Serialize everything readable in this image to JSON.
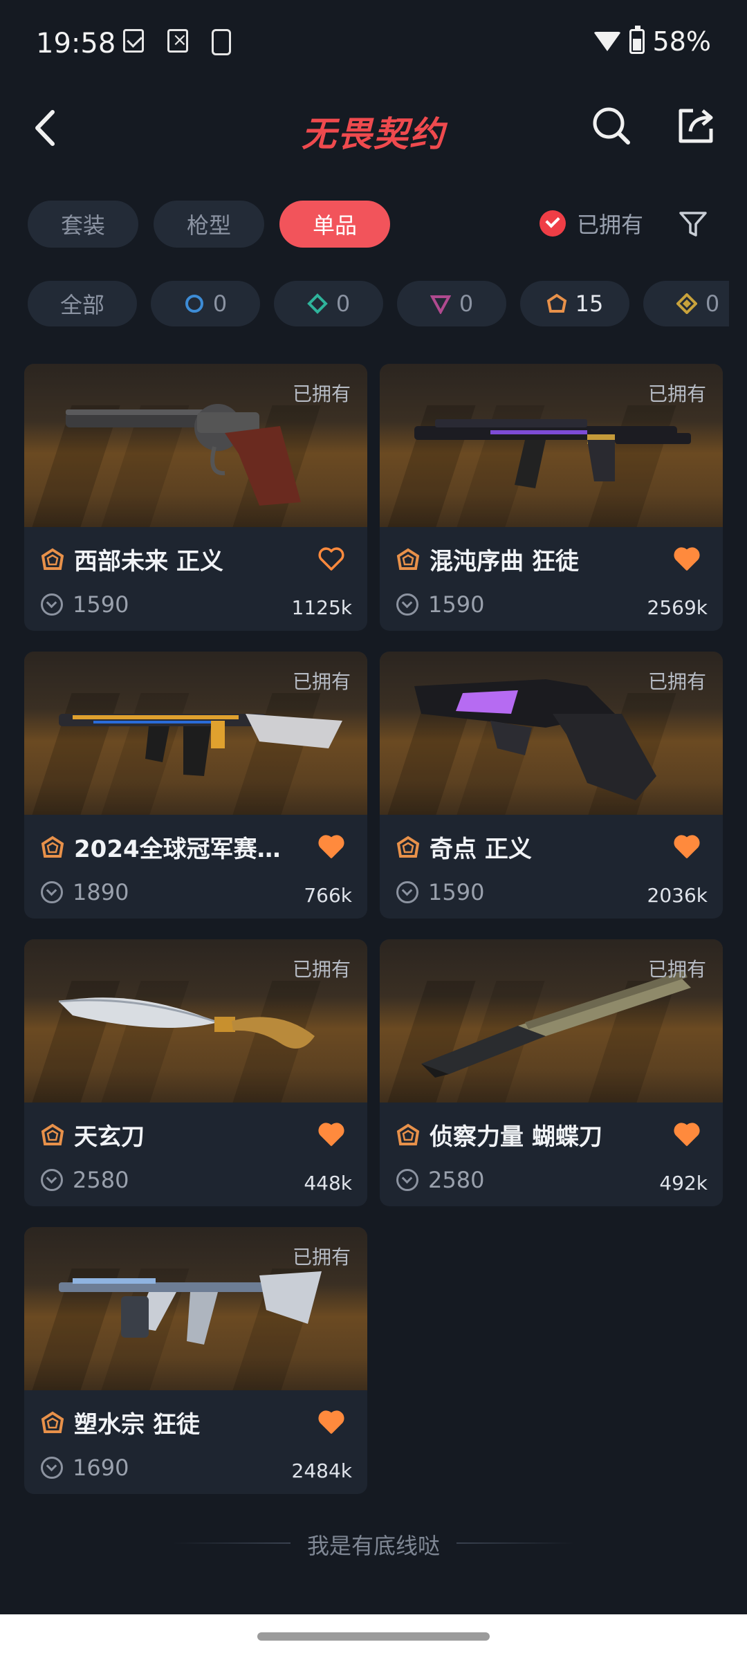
{
  "status_bar": {
    "time": "19:58",
    "battery": "58%"
  },
  "header": {
    "logo": "无畏契约"
  },
  "tabs": [
    {
      "label": "套装",
      "active": false
    },
    {
      "label": "枪型",
      "active": false
    },
    {
      "label": "单品",
      "active": true
    }
  ],
  "owned_filter": {
    "label": "已拥有",
    "checked": true
  },
  "chips": [
    {
      "label": "全部",
      "count": "",
      "tier": "all",
      "color": ""
    },
    {
      "label": "",
      "count": "0",
      "tier": "select",
      "color": "#3d8cd6"
    },
    {
      "label": "",
      "count": "0",
      "tier": "deluxe",
      "color": "#2fb39b"
    },
    {
      "label": "",
      "count": "0",
      "tier": "premium",
      "color": "#b04a8f"
    },
    {
      "label": "",
      "count": "15",
      "tier": "exclusive",
      "color": "#e8914a"
    },
    {
      "label": "",
      "count": "0",
      "tier": "ultra",
      "color": "#c8a23c"
    }
  ],
  "owned_tag": "已拥有",
  "items": [
    {
      "name": "西部未来 正义",
      "price": "1590",
      "likes": "1125k",
      "liked": false,
      "gun": "revolver"
    },
    {
      "name": "混沌序曲 狂徒",
      "price": "1590",
      "likes": "2569k",
      "liked": true,
      "gun": "rifle-dark"
    },
    {
      "name": "2024全球冠军赛…",
      "price": "1890",
      "likes": "766k",
      "liked": true,
      "gun": "rifle-gold"
    },
    {
      "name": "奇点 正义",
      "price": "1590",
      "likes": "2036k",
      "liked": true,
      "gun": "revolver-dark"
    },
    {
      "name": "天玄刀",
      "price": "2580",
      "likes": "448k",
      "liked": true,
      "gun": "knife-curved"
    },
    {
      "name": "侦察力量 蝴蝶刀",
      "price": "2580",
      "likes": "492k",
      "liked": true,
      "gun": "knife-butterfly"
    },
    {
      "name": "塑水宗 狂徒",
      "price": "1690",
      "likes": "2484k",
      "liked": true,
      "gun": "rifle-chrome"
    }
  ],
  "footer": {
    "text": "我是有底线哒"
  },
  "colors": {
    "accent": "#f2545b",
    "heart": "#ff8a3d",
    "exclusive": "#e8914a"
  }
}
